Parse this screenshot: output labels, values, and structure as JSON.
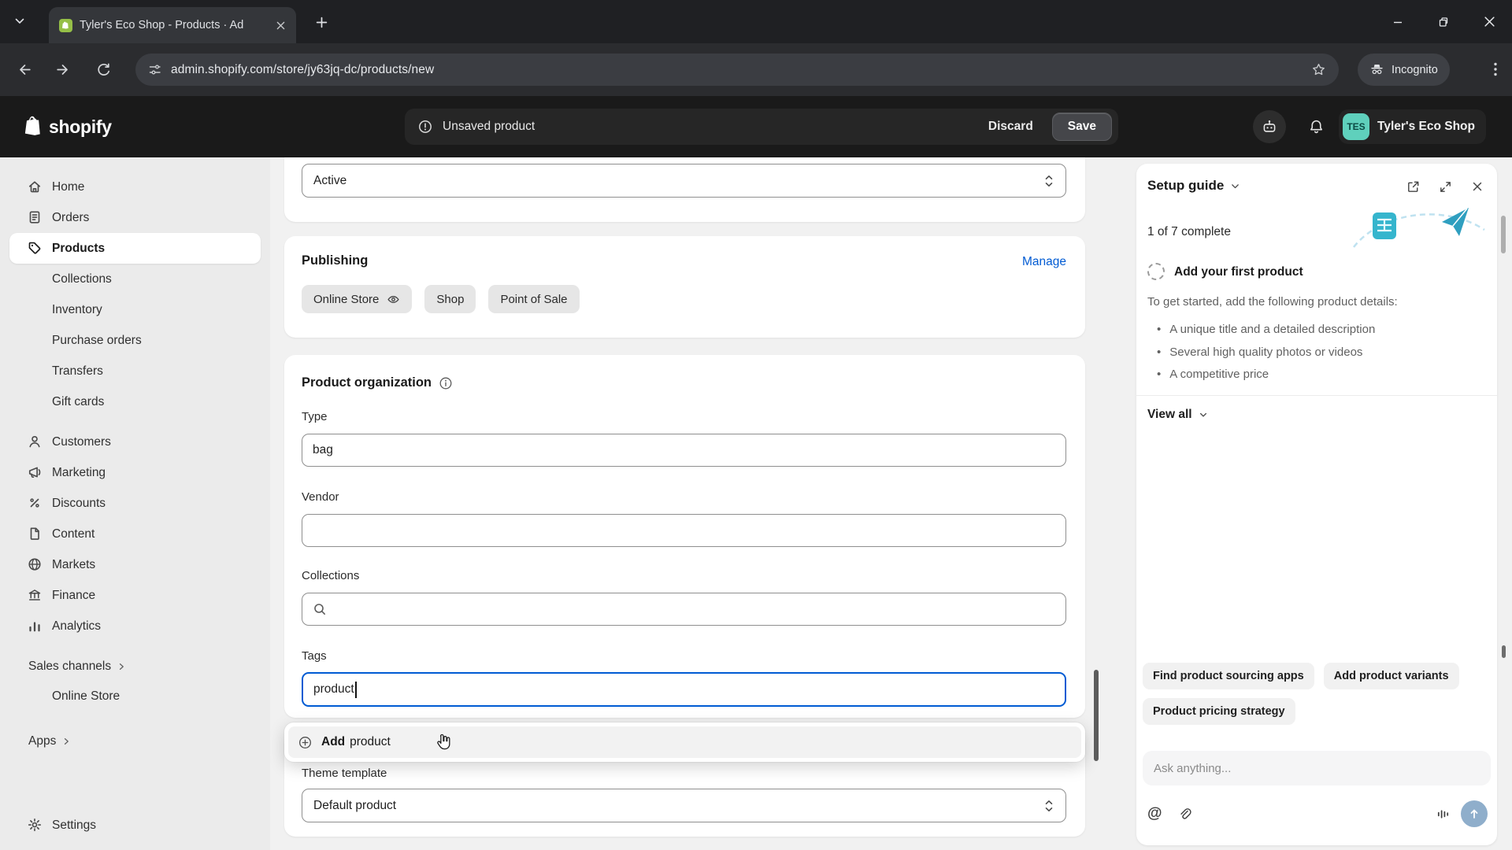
{
  "browser": {
    "tab_title": "Tyler's Eco Shop - Products · Ad",
    "url": "admin.shopify.com/store/jy63jq-dc/products/new",
    "incognito_label": "Incognito"
  },
  "topbar": {
    "logo_text": "shopify",
    "unsaved_label": "Unsaved product",
    "discard_label": "Discard",
    "save_label": "Save",
    "store_name": "Tyler's Eco Shop",
    "avatar_initials": "TES"
  },
  "sidebar": {
    "items": [
      {
        "label": "Home"
      },
      {
        "label": "Orders"
      },
      {
        "label": "Products"
      },
      {
        "label": "Collections"
      },
      {
        "label": "Inventory"
      },
      {
        "label": "Purchase orders"
      },
      {
        "label": "Transfers"
      },
      {
        "label": "Gift cards"
      },
      {
        "label": "Customers"
      },
      {
        "label": "Marketing"
      },
      {
        "label": "Discounts"
      },
      {
        "label": "Content"
      },
      {
        "label": "Markets"
      },
      {
        "label": "Finance"
      },
      {
        "label": "Analytics"
      }
    ],
    "sales_channels_header": "Sales channels",
    "online_store_label": "Online Store",
    "apps_header": "Apps",
    "settings_label": "Settings"
  },
  "main": {
    "status": {
      "value": "Active"
    },
    "publishing": {
      "title": "Publishing",
      "manage_label": "Manage",
      "channels": [
        "Online Store",
        "Shop",
        "Point of Sale"
      ]
    },
    "organization": {
      "title": "Product organization",
      "type_label": "Type",
      "type_value": "bag",
      "vendor_label": "Vendor",
      "vendor_value": "",
      "collections_label": "Collections",
      "tags_label": "Tags",
      "tags_value": "product",
      "dropdown": {
        "action": "Add",
        "term": "product"
      }
    },
    "theme": {
      "label": "Theme template",
      "value": "Default product"
    }
  },
  "setup_guide": {
    "title": "Setup guide",
    "progress": "1 of 7 complete",
    "step_title": "Add your first product",
    "step_intro": "To get started, add the following product details:",
    "bullets": [
      "A unique title and a detailed description",
      "Several high quality photos or videos",
      "A competitive price"
    ],
    "view_all_label": "View all",
    "suggestions": [
      "Find product sourcing apps",
      "Add product variants",
      "Product pricing strategy"
    ],
    "ask_placeholder": "Ask anything..."
  },
  "colors": {
    "accent_blue": "#005bd3",
    "illustration_teal": "#35b5cd",
    "avatar_teal": "#5fd0bc"
  }
}
